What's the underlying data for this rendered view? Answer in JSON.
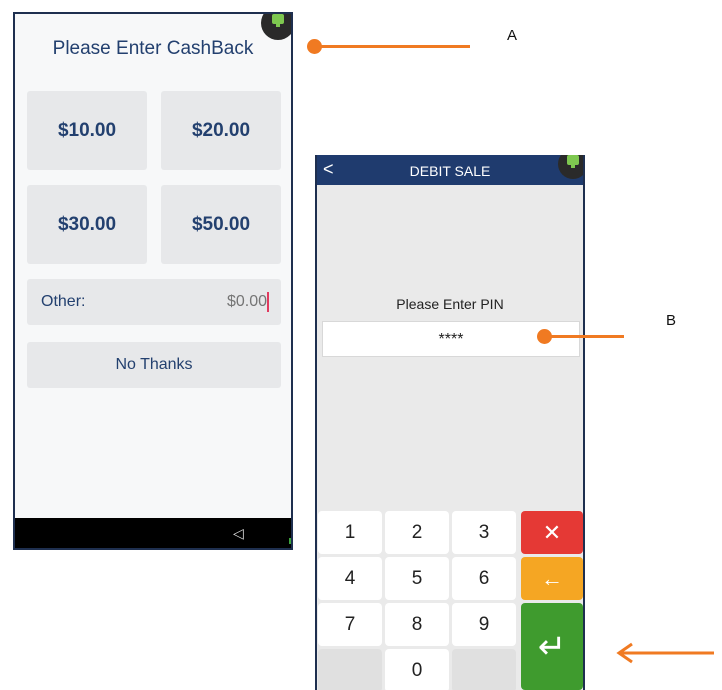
{
  "screen_a": {
    "title": "Please Enter CashBack",
    "amounts": [
      "$10.00",
      "$20.00",
      "$30.00",
      "$50.00"
    ],
    "other_label": "Other:",
    "other_value": "$0.00",
    "no_thanks": "No Thanks",
    "nav_back_glyph": "◁",
    "status_icon": "terminal-status-icon"
  },
  "screen_b": {
    "back_glyph": "<",
    "title": "DEBIT SALE",
    "pin_prompt": "Please Enter PIN",
    "pin_value": "****",
    "keys": [
      "1",
      "2",
      "3",
      "4",
      "5",
      "6",
      "7",
      "8",
      "9",
      "0"
    ],
    "cancel_glyph": "✕",
    "clear_glyph": "←",
    "enter_glyph": "↵",
    "status_icon": "terminal-status-icon"
  },
  "annotations": {
    "label_a": "A",
    "label_b": "B"
  },
  "colors": {
    "header_blue": "#1f3b6e",
    "text_blue": "#23406f",
    "annotation_orange": "#f07a22",
    "cancel_red": "#e53935",
    "clear_amber": "#f5a623",
    "enter_green": "#3f9b2e"
  }
}
